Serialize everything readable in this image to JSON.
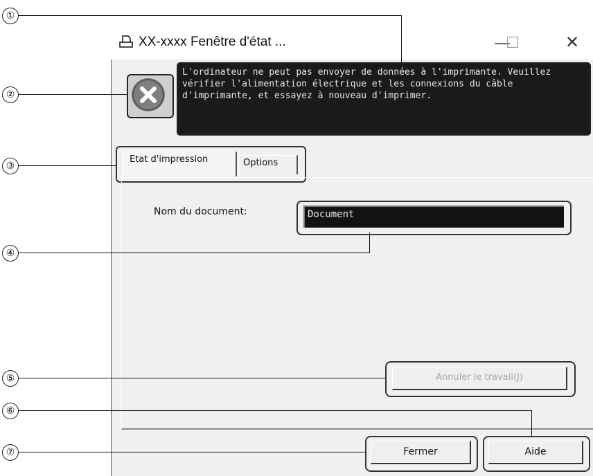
{
  "window": {
    "title": "XX-xxxx Fenêtre d'état ...",
    "controls": {
      "minimize": "—",
      "maximize": "☐",
      "close": "✕"
    }
  },
  "message": "L'ordinateur ne peut pas envoyer de données à l'imprimante. Veuillez vérifier l'alimentation électrique et les connexions du câble d'imprimante, et essayez à nouveau d'imprimer.",
  "tabs": [
    {
      "label": "Etat d'impression"
    },
    {
      "label": "Options"
    }
  ],
  "document": {
    "label": "Nom du document:",
    "value": "Document"
  },
  "buttons": {
    "cancel_job": "Annuler le travail(J)",
    "close": "Fermer",
    "help": "Aide"
  },
  "callouts": [
    "①",
    "②",
    "③",
    "④",
    "⑤",
    "⑥",
    "⑦"
  ],
  "colors": {
    "message_bg": "#1a1a1a",
    "window_bg": "#f0f0f0",
    "error_icon": "#7f7f7f"
  }
}
